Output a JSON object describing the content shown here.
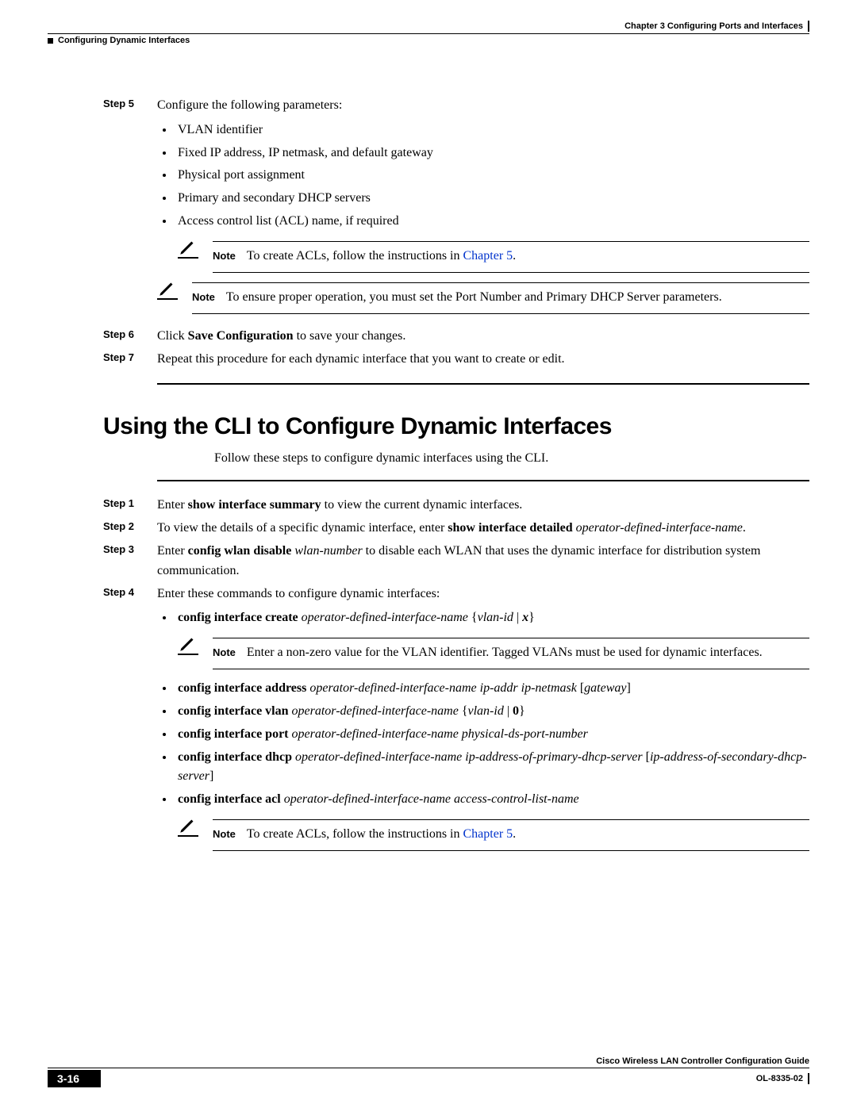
{
  "header": {
    "chapter": "Chapter 3      Configuring Ports and Interfaces",
    "section": "Configuring Dynamic Interfaces"
  },
  "stepsA": {
    "step5": {
      "label": "Step 5",
      "text": "Configure the following parameters:",
      "bullets": [
        "VLAN identifier",
        "Fixed IP address, IP netmask, and default gateway",
        "Physical port assignment",
        "Primary and secondary DHCP servers",
        "Access control list (ACL) name, if required"
      ],
      "note_inner_label": "Note",
      "note_inner_pre": "To create ACLs, follow the instructions in ",
      "note_inner_link": "Chapter 5",
      "note_inner_post": ".",
      "note_outer_label": "Note",
      "note_outer_text": "To ensure proper operation, you must set the Port Number and Primary DHCP Server parameters."
    },
    "step6": {
      "label": "Step 6",
      "pre": "Click ",
      "bold": "Save Configuration",
      "post": " to save your changes."
    },
    "step7": {
      "label": "Step 7",
      "text": "Repeat this procedure for each dynamic interface that you want to create or edit."
    }
  },
  "sectionTitle": "Using the CLI to Configure Dynamic Interfaces",
  "sectionIntro": "Follow these steps to configure dynamic interfaces using the CLI.",
  "stepsB": {
    "step1": {
      "label": "Step 1",
      "pre": "Enter ",
      "bold": "show interface summary",
      "post": " to view the current dynamic interfaces."
    },
    "step2": {
      "label": "Step 2",
      "pre": "To view the details of a specific dynamic interface, enter ",
      "bold": "show interface detailed",
      "post": " ",
      "ital": "operator-defined-interface-name",
      "tail": "."
    },
    "step3": {
      "label": "Step 3",
      "pre": "Enter ",
      "bold": "config wlan disable",
      "mid": " ",
      "ital": "wlan-number",
      "post": " to disable each WLAN that uses the dynamic interface for distribution system communication."
    },
    "step4": {
      "label": "Step 4",
      "text": "Enter these commands to configure dynamic interfaces:",
      "b1": {
        "bold": "config interface create",
        "ital": "operator-defined-interface-name",
        "tail1": " {",
        "ital2": "vlan-id",
        "sep": " | ",
        "bolditalic": "x",
        "tail2": "}"
      },
      "note1_label": "Note",
      "note1_text": "Enter a non-zero value for the VLAN identifier. Tagged VLANs must be used for dynamic interfaces.",
      "b2": {
        "bold": "config interface address",
        "ital": "operator-defined-interface-name ip-addr ip-netmask",
        "tail1": " [",
        "ital2": "gateway",
        "tail2": "]"
      },
      "b3": {
        "bold": "config interface vlan",
        "ital": "operator-defined-interface-name",
        "tail1": " {",
        "ital2": "vlan-id",
        "sep": " | ",
        "bold2": "0",
        "tail2": "}"
      },
      "b4": {
        "bold": "config interface port",
        "ital": "operator-defined-interface-name physical-ds-port-number"
      },
      "b5": {
        "bold": "config interface dhcp",
        "ital": "operator-defined-interface-name ip-address-of-primary-dhcp-server",
        "tail1": " [",
        "ital2": "ip-address-of-secondary-dhcp-server",
        "tail2": "]"
      },
      "b6": {
        "bold": "config interface acl",
        "ital": "operator-defined-interface-name access-control-list-name"
      },
      "note2_label": "Note",
      "note2_pre": "To create ACLs, follow the instructions in ",
      "note2_link": "Chapter 5",
      "note2_post": "."
    }
  },
  "footer": {
    "guide": "Cisco Wireless LAN Controller Configuration Guide",
    "page": "3-16",
    "doc": "OL-8335-02"
  }
}
